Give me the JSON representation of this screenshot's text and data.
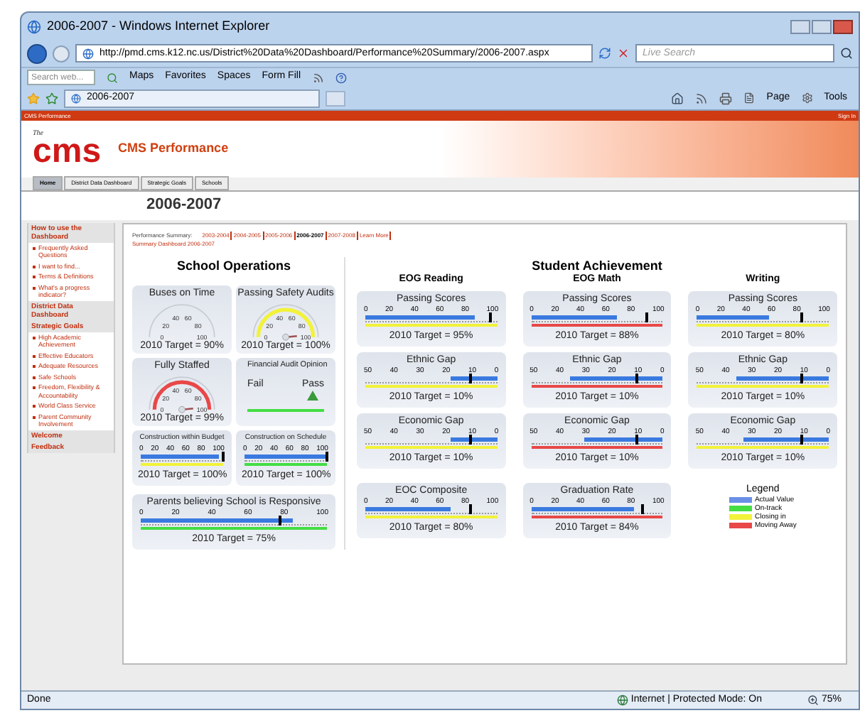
{
  "window": {
    "title": "2006-2007 - Windows Internet Explorer"
  },
  "address_bar": {
    "url": "http://pmd.cms.k12.nc.us/District%20Data%20Dashboard/Performance%20Summary/2006-2007.aspx",
    "search_placeholder": "Live Search"
  },
  "toolbar": {
    "search_placeholder": "Search web...",
    "items": [
      "Maps",
      "Favorites",
      "Spaces",
      "Form Fill"
    ]
  },
  "tab": {
    "title": "2006-2007"
  },
  "command_bar": [
    "Page",
    "Tools"
  ],
  "site": {
    "strip_title": "CMS Performance",
    "sign_in": "Sign In",
    "logo_small": "The",
    "logo": "cms",
    "heading": "CMS Performance",
    "nav": [
      {
        "label": "Home",
        "selected": true
      },
      {
        "label": "District Data Dashboard",
        "selected": false
      },
      {
        "label": "Strategic Goals",
        "selected": false
      },
      {
        "label": "Schools",
        "selected": false
      }
    ],
    "page_title": "2006-2007"
  },
  "sidebar": [
    {
      "heading": "How to use the Dashboard",
      "items": [
        "Frequently Asked Questions",
        "I want to find...",
        "Terms & Definitions",
        "What's a progress indicator?"
      ]
    },
    {
      "heading": "District Data Dashboard"
    },
    {
      "heading": "Strategic Goals",
      "items": [
        "High Academic Achievement",
        "Effective Educators",
        "Adequate Resources",
        "Safe Schools",
        "Freedom, Flexibility & Accountability",
        "World Class Service",
        "Parent Community Involvement"
      ]
    },
    {
      "heading": "Welcome"
    },
    {
      "heading": "Feedback"
    }
  ],
  "summary": {
    "label": "Performance Summary:",
    "years": [
      {
        "label": "2003-2004",
        "selected": false
      },
      {
        "label": "2004-2005",
        "selected": false
      },
      {
        "label": "2005-2006",
        "selected": false
      },
      {
        "label": "2006-2007",
        "selected": true
      },
      {
        "label": "2007-2008",
        "selected": false
      },
      {
        "label": "Learn More",
        "selected": false
      }
    ],
    "breadcrumb": "Summary Dashboard 2006-2007"
  },
  "school_operations": {
    "title": "School Operations",
    "gauges": [
      {
        "kind": "dial",
        "title": "Buses on Time",
        "ticks": [
          "0",
          "20",
          "40",
          "60",
          "80",
          "100"
        ],
        "needle": false,
        "target": "2010 Target = 90%"
      },
      {
        "kind": "dial",
        "title": "Passing Safety Audits",
        "ticks": [
          "0",
          "20",
          "40",
          "60",
          "80",
          "100"
        ],
        "color": "#f2f23a",
        "needle": true,
        "target": "2010 Target = 100%"
      },
      {
        "kind": "dial",
        "title": "Fully Staffed",
        "ticks": [
          "0",
          "20",
          "40",
          "60",
          "80",
          "100"
        ],
        "color": "#e84848",
        "needle": true,
        "target": "2010 Target = 99%"
      },
      {
        "kind": "passfail",
        "title": "Financial Audit Opinion",
        "options": [
          {
            "label": "Fail",
            "selected": false
          },
          {
            "label": "Pass",
            "selected": true
          }
        ],
        "color": "#44dd44"
      },
      {
        "kind": "bullet",
        "title": "Construction within Budget",
        "ticks": [
          "0",
          "20",
          "40",
          "60",
          "80",
          "100"
        ],
        "bar": {
          "level": 0.95,
          "reversed": false
        },
        "marker": {
          "level": 1
        },
        "color": "#f2f23a",
        "target": "2010 Target = 100%"
      },
      {
        "kind": "bullet",
        "title": "Construction on Schedule",
        "ticks": [
          "0",
          "20",
          "40",
          "60",
          "80",
          "100"
        ],
        "bar": {
          "level": 1
        },
        "marker": {
          "level": 1
        },
        "color": "#44dd44",
        "target": "2010 Target = 100%"
      },
      {
        "kind": "wide-bullet",
        "title": "Parents believing School is Responsive",
        "ticks": [
          "0",
          "20",
          "40",
          "60",
          "80",
          "100"
        ],
        "bar": {
          "level": 0.82,
          "reversed": false
        },
        "marker": {
          "level": 0.75
        },
        "color": "#44dd44",
        "target": "2010 Target = 75%"
      }
    ]
  },
  "student_achievement": {
    "title": "Student Achievement",
    "columns": [
      {
        "title": "EOG Reading",
        "gauges": [
          {
            "title": "Passing Scores",
            "ticks": [
              "0",
              "20",
              "40",
              "60",
              "80",
              "100"
            ],
            "bar": {
              "level": 0.83,
              "reversed": false
            },
            "marker": {
              "level": 0.95
            },
            "color": "#f2f23a",
            "target": "2010 Target = 95%"
          },
          {
            "title": "Ethnic Gap",
            "ticks": [
              "50",
              "40",
              "30",
              "20",
              "10",
              "0"
            ],
            "bar": {
              "level": 0.35,
              "reversed": true
            },
            "marker": {
              "level": 0.8
            },
            "color": "#f2f23a",
            "target": "2010 Target = 10%"
          },
          {
            "title": "Economic Gap",
            "ticks": [
              "50",
              "40",
              "30",
              "20",
              "10",
              "0"
            ],
            "bar": {
              "level": 0.35,
              "reversed": true
            },
            "marker": {
              "level": 0.8
            },
            "color": "#f2f23a",
            "target": "2010 Target = 10%"
          }
        ]
      },
      {
        "title": "EOG Math",
        "gauges": [
          {
            "title": "Passing Scores",
            "ticks": [
              "0",
              "20",
              "40",
              "60",
              "80",
              "100"
            ],
            "bar": {
              "level": 0.65,
              "reversed": false
            },
            "marker": {
              "level": 0.88
            },
            "color": "#e84848",
            "target": "2010 Target = 88%"
          },
          {
            "title": "Ethnic Gap",
            "ticks": [
              "50",
              "40",
              "30",
              "20",
              "10",
              "0"
            ],
            "bar": {
              "level": 0.7,
              "reversed": true
            },
            "marker": {
              "level": 0.8
            },
            "color": "#e84848",
            "target": "2010 Target = 10%"
          },
          {
            "title": "Economic Gap",
            "ticks": [
              "50",
              "40",
              "30",
              "20",
              "10",
              "0"
            ],
            "bar": {
              "level": 0.6,
              "reversed": true
            },
            "marker": {
              "level": 0.8
            },
            "color": "#e84848",
            "target": "2010 Target = 10%"
          }
        ]
      },
      {
        "title": "Writing",
        "gauges": [
          {
            "title": "Passing Scores",
            "ticks": [
              "0",
              "20",
              "40",
              "60",
              "80",
              "100"
            ],
            "bar": {
              "level": 0.55,
              "reversed": false
            },
            "marker": {
              "level": 0.8
            },
            "color": "#f2f23a",
            "target": "2010 Target = 80%"
          },
          {
            "title": "Ethnic Gap",
            "ticks": [
              "50",
              "40",
              "30",
              "20",
              "10",
              "0"
            ],
            "bar": {
              "level": 0.7,
              "reversed": true
            },
            "marker": {
              "level": 0.8
            },
            "color": "#f2f23a",
            "target": "2010 Target = 10%"
          },
          {
            "title": "Economic Gap",
            "ticks": [
              "50",
              "40",
              "30",
              "20",
              "10",
              "0"
            ],
            "bar": {
              "level": 0.65,
              "reversed": true
            },
            "marker": {
              "level": 0.8
            },
            "color": "#f2f23a",
            "target": "2010 Target = 10%"
          }
        ]
      }
    ],
    "bottom": [
      {
        "title": "EOC Composite",
        "ticks": [
          "0",
          "20",
          "40",
          "60",
          "80",
          "100"
        ],
        "bar": {
          "level": 0.65,
          "reversed": false
        },
        "marker": {
          "level": 0.8
        },
        "color": "#f2f23a",
        "target": "2010 Target = 80%"
      },
      {
        "title": "Graduation Rate",
        "ticks": [
          "0",
          "20",
          "40",
          "60",
          "80",
          "100"
        ],
        "bar": {
          "level": 0.78,
          "reversed": false
        },
        "marker": {
          "level": 0.84
        },
        "color": "#e84848",
        "target": "2010 Target = 84%"
      }
    ],
    "legend": {
      "title": "Legend",
      "items": [
        {
          "label": "Actual Value",
          "color": "#6a8fe6"
        },
        {
          "label": "On-track",
          "color": "#44dd44"
        },
        {
          "label": "Closing in",
          "color": "#f2f23a"
        },
        {
          "label": "Moving Away",
          "color": "#e84848"
        }
      ]
    }
  },
  "status_bar": {
    "text": "Done",
    "zone": "Internet | Protected Mode: On",
    "zoom": "75%"
  }
}
